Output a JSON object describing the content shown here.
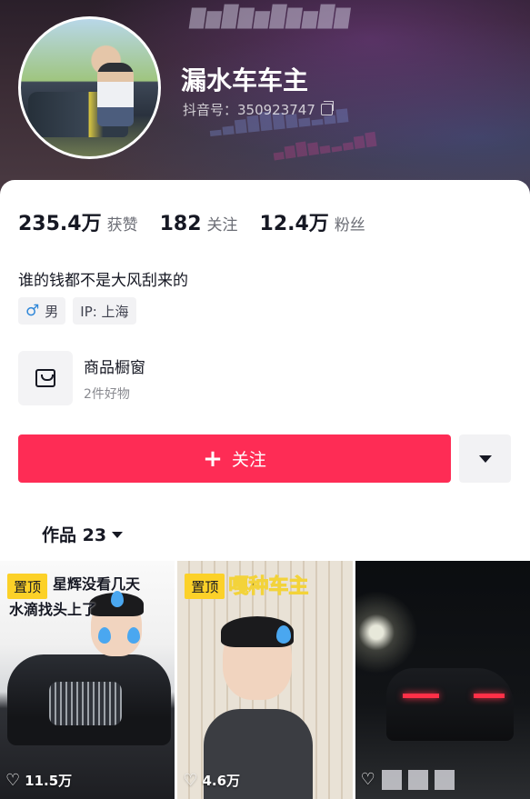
{
  "profile": {
    "nickname": "漏水车车主",
    "douyin_id": "抖音号：350923747",
    "bio": "谁的钱都不是大风刮来的",
    "gender_tag": "男",
    "ip_tag": "IP: 上海"
  },
  "stats": [
    {
      "value": "235.4万",
      "label": "获赞"
    },
    {
      "value": "182",
      "label": "关注"
    },
    {
      "value": "12.4万",
      "label": "粉丝"
    }
  ],
  "shop": {
    "title": "商品橱窗",
    "subtitle": "2件好物"
  },
  "actions": {
    "follow_label": "关注",
    "follow_color": "#fe2c55"
  },
  "works_tab": {
    "label": "作品 23"
  },
  "videos": [
    {
      "pinned": "置顶",
      "caption_line1": "星辉没看几天",
      "caption_line2": "水滴找头上了",
      "likes": "11.5万"
    },
    {
      "pinned": "置顶",
      "title": "嘎种车主",
      "likes": "4.6万"
    },
    {
      "likes": ""
    }
  ],
  "icons": [
    "copy-icon",
    "male-icon",
    "bag-icon",
    "plus-icon",
    "caret-down-icon",
    "heart-icon"
  ]
}
